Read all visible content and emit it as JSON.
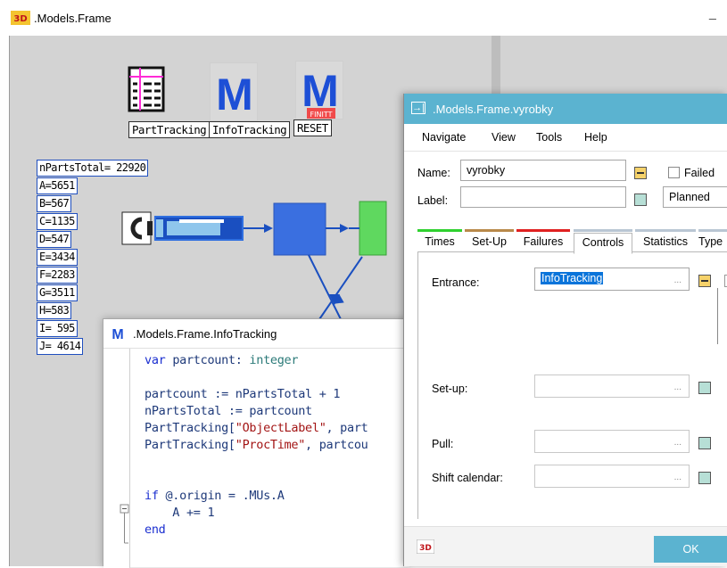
{
  "main_window": {
    "title": ".Models.Frame",
    "logo_text": "3D",
    "minimize_glyph": "_"
  },
  "frame": {
    "icons": [
      {
        "name": "PartTracking",
        "label": "PartTracking"
      },
      {
        "name": "InfoTracking",
        "label": "InfoTracking",
        "glyph": "M"
      },
      {
        "name": "RESET",
        "label": "RESET",
        "glyph": "M",
        "badge": "FINITT"
      }
    ],
    "counters": [
      "nPartsTotal= 22920",
      "A=5651",
      "B=567",
      "C=1135",
      "D=547",
      "E=3434",
      "F=2283",
      "G=3511",
      "H=583",
      "I= 595",
      "J= 4614"
    ]
  },
  "editor": {
    "title": ".Models.Frame.InfoTracking",
    "icon_glyph": "M",
    "lines": [
      {
        "parts": [
          {
            "t": "var ",
            "c": "kw"
          },
          {
            "t": "partcount",
            "c": ""
          },
          {
            "t": ": ",
            "c": ""
          },
          {
            "t": "integer",
            "c": "ty"
          }
        ]
      },
      {
        "parts": []
      },
      {
        "parts": [
          {
            "t": "partcount := nPartsTotal + 1",
            "c": ""
          }
        ]
      },
      {
        "parts": [
          {
            "t": "nPartsTotal := partcount",
            "c": ""
          }
        ]
      },
      {
        "parts": [
          {
            "t": "PartTracking[",
            "c": ""
          },
          {
            "t": "\"ObjectLabel\"",
            "c": "str"
          },
          {
            "t": ", part",
            "c": ""
          }
        ]
      },
      {
        "parts": [
          {
            "t": "PartTracking[",
            "c": ""
          },
          {
            "t": "\"ProcTime\"",
            "c": "str"
          },
          {
            "t": ", partcou",
            "c": ""
          }
        ]
      },
      {
        "parts": []
      },
      {
        "parts": []
      },
      {
        "parts": [
          {
            "t": "if ",
            "c": "kw"
          },
          {
            "t": "@.origin = .MUs.A",
            "c": ""
          }
        ]
      },
      {
        "parts": [
          {
            "t": "    A += 1",
            "c": ""
          }
        ]
      },
      {
        "parts": [
          {
            "t": "end",
            "c": "kw"
          }
        ]
      }
    ]
  },
  "dialog": {
    "title": ".Models.Frame.vyrobky",
    "title_icon": "→|",
    "menu": [
      "Navigate",
      "View",
      "Tools",
      "Help"
    ],
    "name_label": "Name:",
    "name_value": "vyrobky",
    "label_label": "Label:",
    "label_value": "",
    "failed_label": "Failed",
    "planned_value": "Planned",
    "tabs": [
      {
        "label": "Times",
        "color": "#2fd12f"
      },
      {
        "label": "Set-Up",
        "color": "#b8894a"
      },
      {
        "label": "Failures",
        "color": "#e02020"
      },
      {
        "label": "Controls",
        "color": "#b9c6d3",
        "active": true
      },
      {
        "label": "Statistics",
        "color": "#b9c6d3"
      },
      {
        "label": "Type",
        "color": "#b9c6d3"
      }
    ],
    "controls": {
      "entrance_label": "Entrance:",
      "entrance_value": "InfoTracking",
      "setup_label": "Set-up:",
      "pull_label": "Pull:",
      "shift_label": "Shift calendar:",
      "ellipsis": "..."
    },
    "footer_logo": "3D",
    "ok_label": "OK"
  },
  "colors": {
    "dialog_title": "#5bb3d0",
    "counter_border": "#1f4fbf",
    "station_blue": "#3a6fe0",
    "buffer_green": "#5fd85f",
    "buffer_brown": "#b87840"
  }
}
